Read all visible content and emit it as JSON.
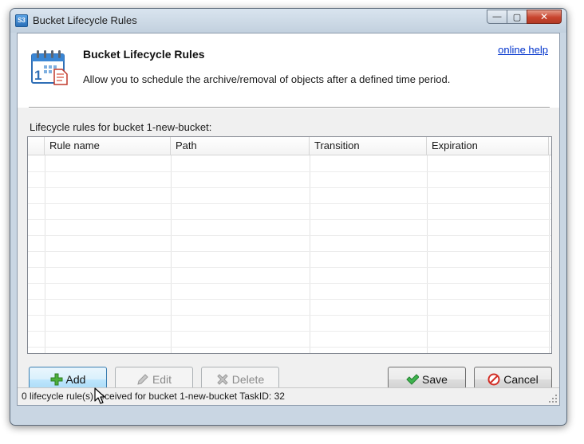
{
  "window": {
    "title": "Bucket Lifecycle Rules",
    "app_icon_text": "S3",
    "caption": {
      "minimize": "—",
      "maximize": "▢",
      "close": "✕"
    }
  },
  "header": {
    "icon": "calendar-icon",
    "title": "Bucket Lifecycle Rules",
    "description": "Allow you to schedule the archive/removal of objects after a defined time period.",
    "help_link": "online help"
  },
  "rules": {
    "label": "Lifecycle rules for bucket 1-new-bucket:",
    "columns": [
      "Rule name",
      "Path",
      "Transition",
      "Expiration"
    ],
    "rows": []
  },
  "buttons": {
    "add": {
      "label": "Add",
      "icon": "plus-icon",
      "enabled": true
    },
    "edit": {
      "label": "Edit",
      "icon": "pencil-icon",
      "enabled": false
    },
    "delete": {
      "label": "Delete",
      "icon": "delete-x-icon",
      "enabled": false
    },
    "save": {
      "label": "Save",
      "icon": "checkmark-icon"
    },
    "cancel": {
      "label": "Cancel",
      "icon": "no-entry-icon"
    }
  },
  "status": {
    "text": "0 lifecycle rule(s) received for bucket 1-new-bucket TaskID: 32"
  },
  "colors": {
    "link": "#0033cc",
    "hover_button": "#bee6fd",
    "close_button": "#c8442e"
  }
}
